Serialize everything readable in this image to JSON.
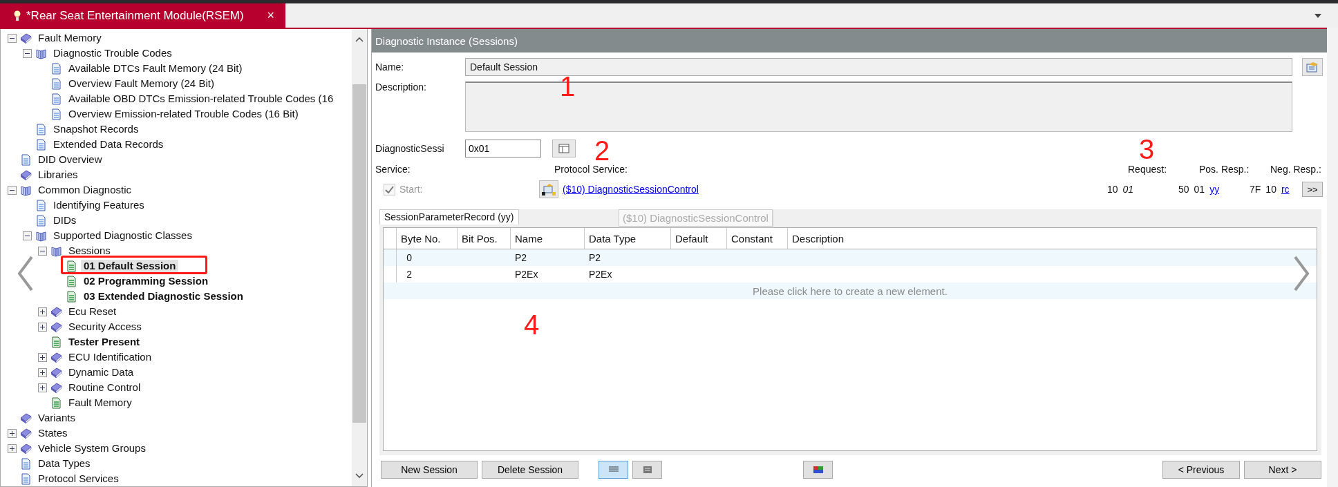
{
  "tab": {
    "title": "*Rear Seat Entertainment Module(RSEM)",
    "close": "×",
    "selected": true
  },
  "tree": [
    {
      "label": "Fault Memory",
      "kind": "book",
      "bold": false,
      "selected": false,
      "expanded": true,
      "children": [
        {
          "label": "Diagnostic Trouble Codes",
          "kind": "books",
          "bold": false,
          "selected": false,
          "expanded": true,
          "children": [
            {
              "label": "Available DTCs Fault Memory (24 Bit)",
              "kind": "page",
              "bold": false,
              "selected": false
            },
            {
              "label": "Overview Fault Memory (24 Bit)",
              "kind": "page",
              "bold": false,
              "selected": false
            },
            {
              "label": "Available OBD DTCs Emission-related Trouble Codes (16",
              "kind": "page",
              "bold": false,
              "selected": false
            },
            {
              "label": "Overview Emission-related Trouble Codes (16 Bit)",
              "kind": "page",
              "bold": false,
              "selected": false
            }
          ]
        },
        {
          "label": "Snapshot Records",
          "kind": "page",
          "bold": false,
          "selected": false
        },
        {
          "label": "Extended Data Records",
          "kind": "page",
          "bold": false,
          "selected": false
        }
      ]
    },
    {
      "label": "DID Overview",
      "kind": "page",
      "bold": false,
      "selected": false
    },
    {
      "label": "Libraries",
      "kind": "book",
      "bold": false,
      "selected": false
    },
    {
      "label": "Common Diagnostic",
      "kind": "books",
      "bold": false,
      "selected": false,
      "expanded": true,
      "children": [
        {
          "label": "Identifying Features",
          "kind": "page",
          "bold": false,
          "selected": false
        },
        {
          "label": "DIDs",
          "kind": "page",
          "bold": false,
          "selected": false
        },
        {
          "label": "Supported Diagnostic Classes",
          "kind": "books",
          "bold": false,
          "selected": false,
          "expanded": true,
          "children": [
            {
              "label": "Sessions",
              "kind": "books",
              "bold": false,
              "selected": false,
              "expanded": true,
              "children": [
                {
                  "label": "01 Default Session",
                  "kind": "green-page",
                  "bold": true,
                  "selected": true
                },
                {
                  "label": "02 Programming Session",
                  "kind": "green-page",
                  "bold": true,
                  "selected": false
                },
                {
                  "label": "03 Extended Diagnostic Session",
                  "kind": "green-page",
                  "bold": true,
                  "selected": false
                }
              ]
            },
            {
              "label": "Ecu Reset",
              "kind": "book",
              "bold": false,
              "selected": false,
              "expanded": false
            },
            {
              "label": "Security Access",
              "kind": "book",
              "bold": false,
              "selected": false,
              "expanded": false
            },
            {
              "label": "Tester Present",
              "kind": "green-page",
              "bold": true,
              "selected": false
            },
            {
              "label": "ECU Identification",
              "kind": "book",
              "bold": false,
              "selected": false,
              "expanded": false
            },
            {
              "label": "Dynamic Data",
              "kind": "book",
              "bold": false,
              "selected": false,
              "expanded": false
            },
            {
              "label": "Routine Control",
              "kind": "book",
              "bold": false,
              "selected": false,
              "expanded": false
            },
            {
              "label": "Fault Memory",
              "kind": "green-page",
              "bold": false,
              "selected": false
            }
          ]
        }
      ]
    },
    {
      "label": "Variants",
      "kind": "book",
      "bold": false,
      "selected": false
    },
    {
      "label": "States",
      "kind": "book",
      "bold": false,
      "selected": false,
      "expanded": false
    },
    {
      "label": "Vehicle System Groups",
      "kind": "book",
      "bold": false,
      "selected": false,
      "expanded": false
    },
    {
      "label": "Data Types",
      "kind": "page",
      "bold": false,
      "selected": false
    },
    {
      "label": "Protocol Services",
      "kind": "page",
      "bold": false,
      "selected": false
    }
  ],
  "panel": {
    "title": "Diagnostic Instance (Sessions)",
    "name": {
      "label": "Name:",
      "value": "Default Session"
    },
    "description": {
      "label": "Description:"
    },
    "session": {
      "label": "DiagnosticSessi",
      "value": "0x01"
    },
    "service": {
      "label": "Service:",
      "start": {
        "label": "Start:",
        "checked": true,
        "disabled": true
      }
    },
    "protocol_service": {
      "label": "Protocol Service:",
      "link": "($10) DiagnosticSessionControl",
      "tooltip": "($10) DiagnosticSessionControl"
    },
    "messages": [
      {
        "label": "Request:",
        "parts": [
          {
            "text": "10",
            "kind": "plain"
          },
          {
            "text": "01",
            "kind": "italic"
          }
        ]
      },
      {
        "label": "Pos. Resp.:",
        "parts": [
          {
            "text": "50",
            "kind": "plain"
          },
          {
            "text": "01",
            "kind": "plain"
          },
          {
            "text": "yy",
            "kind": "link"
          }
        ]
      },
      {
        "label": "Neg. Resp.:",
        "parts": [
          {
            "text": "7F",
            "kind": "plain"
          },
          {
            "text": "10",
            "kind": "plain"
          },
          {
            "text": "rc",
            "kind": "link"
          }
        ]
      }
    ],
    "more_button": ">>",
    "record_tab": {
      "label": "SessionParameterRecord (yy)",
      "selected": true
    },
    "table": {
      "columns": [
        "Byte No.",
        "Bit Pos.",
        "Name",
        "Data Type",
        "Default",
        "Constant",
        "Description"
      ],
      "rows": [
        {
          "cells": [
            "0",
            null,
            "P2",
            "P2",
            null,
            null,
            null
          ]
        },
        {
          "cells": [
            "2",
            null,
            "P2Ex",
            "P2Ex",
            null,
            null,
            null
          ]
        }
      ],
      "new_row": "Please click here to create a new element."
    },
    "buttons": [
      {
        "label": "New Session",
        "kind": "text"
      },
      {
        "label": "Delete Session",
        "kind": "text"
      },
      {
        "kind": "list-view",
        "selected": true
      },
      {
        "kind": "form-view",
        "selected": false
      },
      {
        "kind": "color"
      },
      {
        "label": "< Previous",
        "kind": "text"
      },
      {
        "label": "Next >",
        "kind": "text"
      }
    ]
  },
  "annotations": [
    {
      "text": "1",
      "kind": "number"
    },
    {
      "text": "2",
      "kind": "number"
    },
    {
      "text": "3",
      "kind": "number"
    },
    {
      "text": "4",
      "kind": "number"
    },
    {
      "kind": "frame"
    }
  ]
}
